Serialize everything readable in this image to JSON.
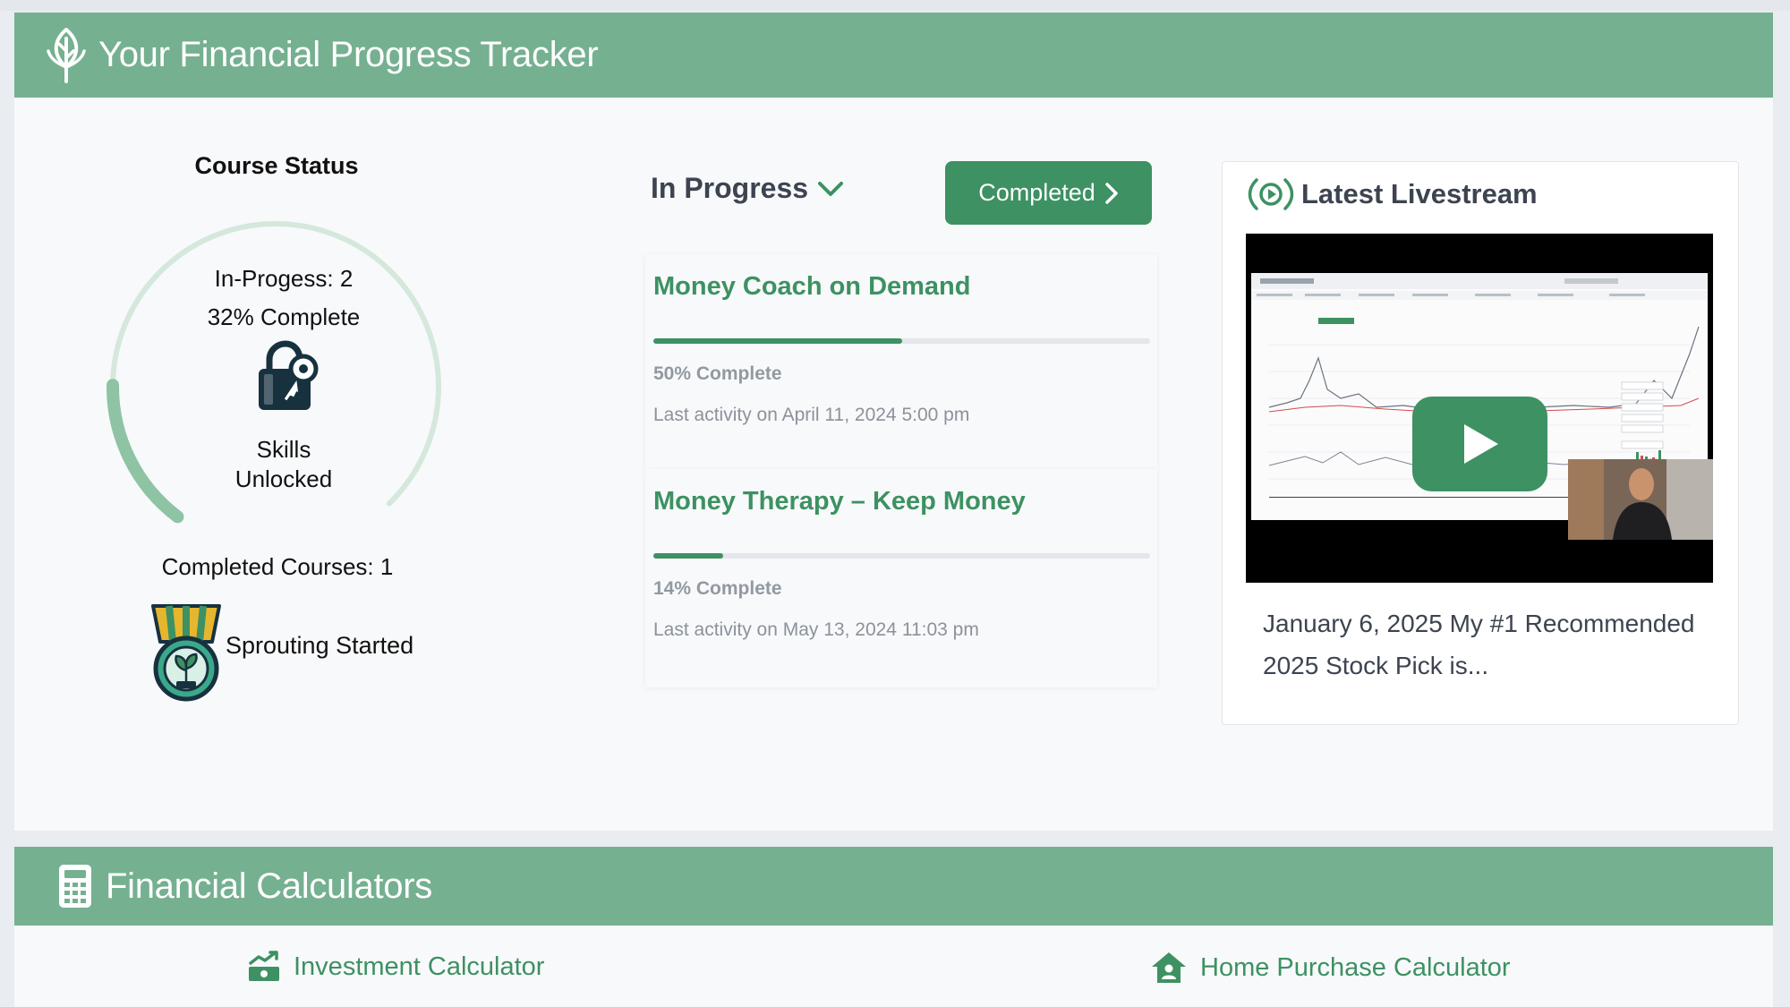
{
  "tracker": {
    "title": "Your Financial Progress Tracker",
    "icon": "leaf-icon"
  },
  "course_status": {
    "title": "Course Status",
    "in_progress_label": "In-Progess: 2",
    "percent_label": "32% Complete",
    "percent_value": 32,
    "skills_label_line1": "Skills",
    "skills_label_line2": "Unlocked",
    "completed_label": "Completed Courses: 1",
    "badge_label": "Sprouting Started"
  },
  "tabs": {
    "in_progress": "In Progress",
    "completed": "Completed"
  },
  "courses": [
    {
      "title": "Money Coach on Demand",
      "progress": 50,
      "percent_label": "50% Complete",
      "activity": "Last activity on April 11, 2024 5:00 pm"
    },
    {
      "title": "Money Therapy – Keep Money",
      "progress": 14,
      "percent_label": "14% Complete",
      "activity": "Last activity on May 13, 2024 11:03 pm"
    }
  ],
  "livestream": {
    "title": "Latest Livestream",
    "caption": "January 6, 2025 My #1 Recommended 2025 Stock Pick is..."
  },
  "calculators": {
    "title": "Financial Calculators",
    "investment": "Investment Calculator",
    "home_purchase": "Home Purchase Calculator"
  },
  "colors": {
    "banner": "#75b090",
    "accent": "#3d9162",
    "ring": "#c8e2d3"
  }
}
